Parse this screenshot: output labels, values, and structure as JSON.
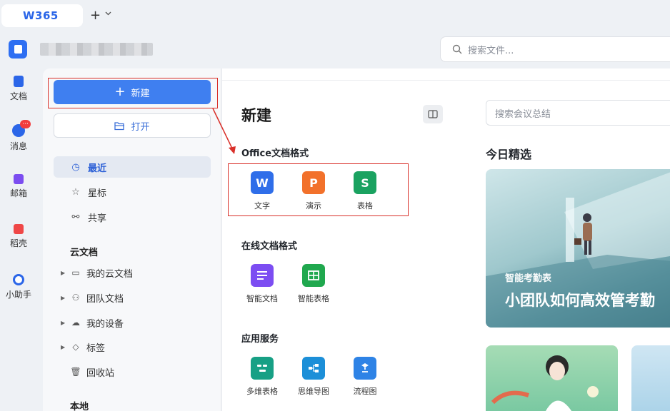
{
  "tabbar": {
    "logo_text": "W365",
    "add_tab": "+",
    "add_tab_caret": "⌄"
  },
  "header": {
    "search_placeholder": "搜索文件..."
  },
  "rail": {
    "items": [
      {
        "label": "文档",
        "icon": "doc-icon",
        "color": "#2b66e8"
      },
      {
        "label": "消息",
        "icon": "message-icon",
        "color": "#2b66e8",
        "badge": "···"
      },
      {
        "label": "邮箱",
        "icon": "mail-icon",
        "color": "#7b4df0"
      },
      {
        "label": "稻壳",
        "icon": "docer-icon",
        "color": "#ef4747"
      },
      {
        "label": "小助手",
        "icon": "assistant-icon",
        "color": "#2b66e8"
      }
    ]
  },
  "sidebar": {
    "new_label": "新建",
    "open_label": "打开",
    "nav": [
      {
        "label": "最近",
        "icon": "clock-icon",
        "glyph": "◷"
      },
      {
        "label": "星标",
        "icon": "star-icon",
        "glyph": "☆"
      },
      {
        "label": "共享",
        "icon": "share-icon",
        "glyph": "⚯"
      }
    ],
    "cloud_section": "云文档",
    "tree": [
      {
        "label": "我的云文档",
        "icon": "folder-icon",
        "glyph": "▭"
      },
      {
        "label": "团队文档",
        "icon": "team-icon",
        "glyph": "⚇"
      },
      {
        "label": "我的设备",
        "icon": "cloud-device-icon",
        "glyph": "☁"
      },
      {
        "label": "标签",
        "icon": "tag-icon",
        "glyph": "◇"
      }
    ],
    "trash_label": "回收站",
    "local_section": "本地"
  },
  "main": {
    "title": "新建",
    "groups": [
      {
        "title": "Office文档格式",
        "tiles": [
          {
            "label": "文字",
            "letter": "W",
            "color": "#2f6ee9"
          },
          {
            "label": "演示",
            "letter": "P",
            "color": "#f2712b"
          },
          {
            "label": "表格",
            "letter": "S",
            "color": "#1aa260"
          }
        ]
      },
      {
        "title": "在线文档格式",
        "tiles": [
          {
            "label": "智能文档",
            "letter": "≡",
            "color": "#7c4df2"
          },
          {
            "label": "智能表格",
            "letter": "⊞",
            "color": "#20a84e"
          }
        ]
      },
      {
        "title": "应用服务",
        "tiles": [
          {
            "label": "多维表格",
            "letter": "≋",
            "color": "#17a085"
          },
          {
            "label": "思维导图",
            "letter": "⊶",
            "color": "#1c8fd8"
          },
          {
            "label": "流程图",
            "letter": "∂",
            "color": "#2e83e6"
          }
        ]
      }
    ],
    "meeting_search_placeholder": "搜索会议总结",
    "today_title": "今日精选",
    "banner": {
      "subtitle": "智能考勤表",
      "title": "小团队如何高效管考勤"
    }
  },
  "colors": {
    "accent": "#3f7ff0",
    "annotation": "#d9302a"
  }
}
